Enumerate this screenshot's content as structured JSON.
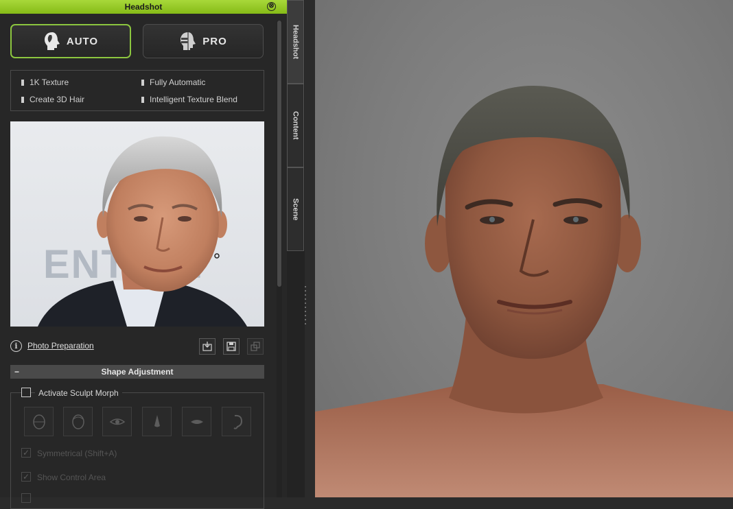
{
  "window": {
    "title": "Headshot",
    "close_glyph": "⊗"
  },
  "modes": {
    "auto": {
      "label": "AUTO",
      "icon": "auto-head-icon",
      "selected": true
    },
    "pro": {
      "label": "PRO",
      "icon": "pro-head-icon",
      "selected": false
    }
  },
  "features": [
    "1K Texture",
    "Fully Automatic",
    "Create 3D Hair",
    "Intelligent Texture Blend"
  ],
  "photo": {
    "backdrop_text": "ENTERT"
  },
  "photo_prep": {
    "info_glyph": "i",
    "link": "Photo Preparation",
    "buttons": [
      "import-photo-icon",
      "save-icon",
      "copy-icon"
    ]
  },
  "shape_adjustment": {
    "title": "Shape Adjustment",
    "collapse_glyph": "−",
    "sculpt_label": "Activate Sculpt Morph",
    "parts": [
      "face-part-icon",
      "head-part-icon",
      "eye-part-icon",
      "nose-part-icon",
      "mouth-part-icon",
      "ear-part-icon"
    ],
    "options": [
      {
        "label": "Symmetrical (Shift+A)",
        "checked": true
      },
      {
        "label": "Show Control Area",
        "checked": true
      }
    ]
  },
  "tabs": [
    "Headshot",
    "Content",
    "Scene"
  ],
  "colors": {
    "accent": "#8cc63f",
    "panel_bg": "#272727",
    "viewport_bg": "#7c7c7c"
  }
}
